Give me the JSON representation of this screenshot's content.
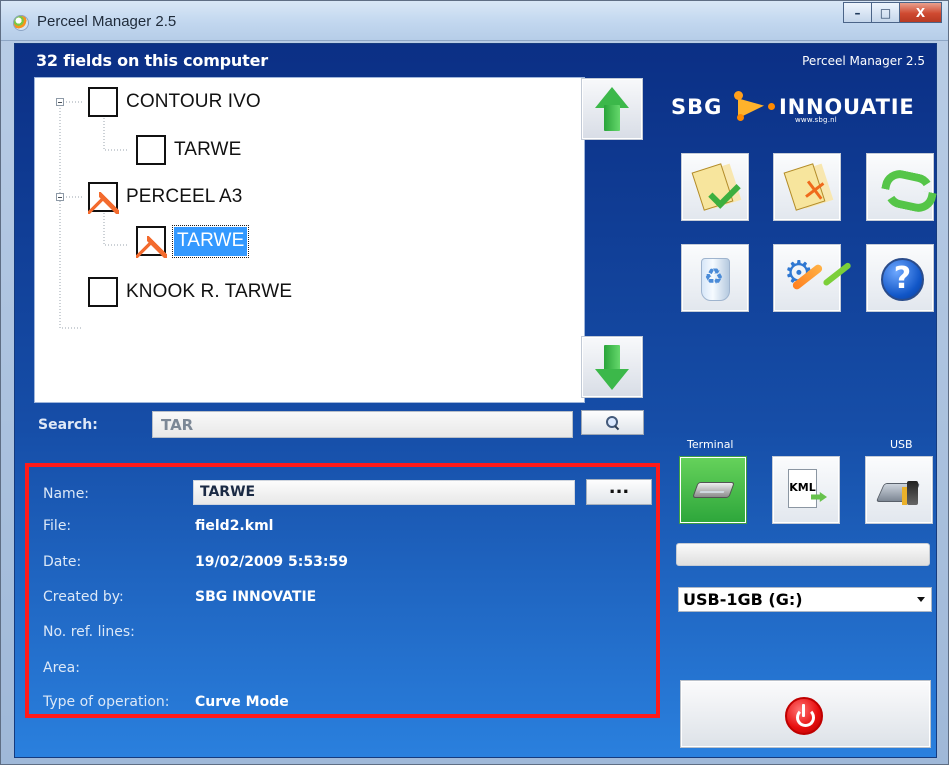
{
  "window": {
    "title": "Perceel Manager 2.5",
    "controls": {
      "minimize": "–",
      "maximize": "□",
      "close": "X"
    }
  },
  "header": {
    "field_count": "32 fields on this computer",
    "version": "Perceel Manager 2.5"
  },
  "tree": {
    "items": [
      {
        "label": "CONTOUR IVO",
        "checked": false,
        "level": 0
      },
      {
        "label": "TARWE",
        "checked": false,
        "level": 1
      },
      {
        "label": "PERCEEL A3",
        "checked": true,
        "level": 0
      },
      {
        "label": "TARWE",
        "checked": true,
        "level": 1,
        "selected": true
      },
      {
        "label": "KNOOK R. TARWE",
        "checked": false,
        "level": 0
      }
    ]
  },
  "search": {
    "label": "Search:",
    "value": "TAR"
  },
  "details": {
    "name_label": "Name:",
    "name_value": "TARWE",
    "browse_button": "...",
    "file_label": "File:",
    "file_value": "field2.kml",
    "date_label": "Date:",
    "date_value": "19/02/2009 5:53:59",
    "created_by_label": "Created by:",
    "created_by_value": "SBG INNOVATIE",
    "ref_lines_label": "No. ref. lines:",
    "ref_lines_value": "",
    "area_label": "Area:",
    "area_value": "",
    "operation_label": "Type of operation:",
    "operation_value": "Curve Mode"
  },
  "brand": {
    "left": "SBG",
    "right": "INNOUATIE",
    "url": "www.sbg.nl"
  },
  "transfer": {
    "terminal_label": "Terminal",
    "usb_label": "USB",
    "drive_selected": "USB-1GB (G:)"
  },
  "icons": {
    "up": "up-arrow-icon",
    "down": "down-arrow-icon",
    "search": "search-icon",
    "accept": "documents-check-icon",
    "reject": "documents-x-icon",
    "refresh": "refresh-icon",
    "trash": "trash-icon",
    "settings": "settings-tools-icon",
    "help": "help-icon",
    "terminal": "terminal-drive-icon",
    "kml": "kml-export-icon",
    "usb": "usb-drive-icon",
    "power": "power-icon"
  },
  "colors": {
    "panel_top": "#0b2f85",
    "panel_bottom": "#2a80de",
    "highlight_border": "#ff1a1a",
    "selected_item": "#3399ff",
    "checkmark": "#f36b2e"
  }
}
